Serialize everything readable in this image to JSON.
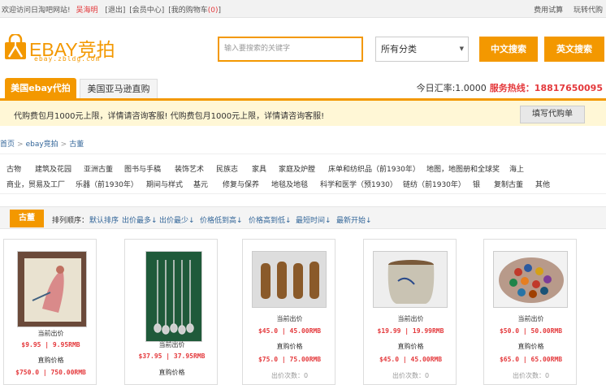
{
  "topbar": {
    "welcome": "欢迎访问日淘吧网站!",
    "username": "吴海明",
    "logout": "[退出]",
    "member": "[会员中心]",
    "cart": "[我的购物车",
    "cart_count": "(0)",
    "cart_close": "]",
    "fee_calc": "费用试算",
    "play_guide": "玩转代购"
  },
  "header": {
    "brand": "EBAY竞拍",
    "domain": "ebay.zbldg.com",
    "search_placeholder": "输入要搜索的关键字",
    "category_selected": "所有分类",
    "search_cn": "中文搜索",
    "search_en": "英文搜索",
    "accent": "#f39800"
  },
  "tabs": [
    {
      "label": "美国ebay代拍",
      "active": true
    },
    {
      "label": "美国亚马逊直购",
      "active": false
    }
  ],
  "rate": {
    "label": "今日汇率:1.0000",
    "hotline": "服务热线：18817650095"
  },
  "notice": {
    "text": "代购费包月1000元上限，详情请咨询客服! 代购费包月1000元上限，详情请咨询客服!",
    "fill_button": "填写代购单"
  },
  "breadcrumb": [
    "首页",
    "ebay竞拍",
    "古董"
  ],
  "categories": {
    "row1": [
      "古物",
      "建筑及花园",
      "亚洲古董",
      "图书与手稿",
      "装饰艺术",
      "民族志",
      "家具",
      "家庭及炉膛",
      "床单和纺织品（前1930年）",
      "地图，地图册和全球奖",
      "海上"
    ],
    "row2": [
      "商业，贸易及工厂",
      "乐器（前1930年）",
      "期间与样式",
      "基元",
      "修复与保养",
      "地毯及地毯",
      "科学和医学（预1930）",
      "链纺（前1930年）",
      "银",
      "复制古董",
      "其他"
    ]
  },
  "sort": {
    "current": "古董",
    "label": "排列顺序：",
    "options": [
      "默认排序",
      "出价最多",
      "出价最少",
      "价格低到高",
      "价格高到低",
      "最短时间",
      "最新开始"
    ]
  },
  "products": [
    {
      "name": "painting",
      "current_label": "当前出价",
      "current": "$9.95 | 9.95RMB",
      "direct_label": "直购价格",
      "direct": "$750.0 | 750.00RMB"
    },
    {
      "name": "spoons",
      "current_label": "当前出价",
      "current": "$37.95 | 37.95RMB",
      "direct_label": "直购价格",
      "direct": ""
    },
    {
      "name": "bullets",
      "current_label": "当前出价",
      "current": "$45.0 | 45.00RMB",
      "direct_label": "直购价格",
      "direct": "$75.0 | 75.00RMB",
      "bids": "出价次数：0"
    },
    {
      "name": "crock",
      "current_label": "当前出价",
      "current": "$19.99 | 19.99RMB",
      "direct_label": "直购价格",
      "direct": "$45.0 | 45.00RMB",
      "bids": "出价次数：0"
    },
    {
      "name": "caps",
      "current_label": "当前出价",
      "current": "$50.0 | 50.00RMB",
      "direct_label": "直购价格",
      "direct": "$65.0 | 65.00RMB",
      "bids": "出价次数：0"
    }
  ]
}
